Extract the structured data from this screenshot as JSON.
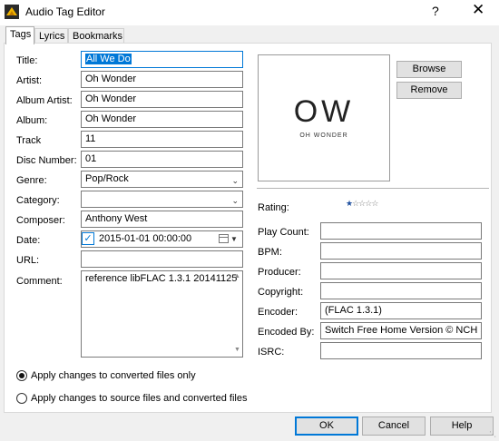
{
  "window": {
    "title": "Audio Tag Editor",
    "help": "?",
    "close": "✕"
  },
  "tabs": [
    "Tags",
    "Lyrics",
    "Bookmarks"
  ],
  "fields": {
    "title": {
      "label": "Title:",
      "value": "All We Do"
    },
    "artist": {
      "label": "Artist:",
      "value": "Oh Wonder"
    },
    "album_artist": {
      "label": "Album Artist:",
      "value": "Oh Wonder"
    },
    "album": {
      "label": "Album:",
      "value": "Oh Wonder"
    },
    "track": {
      "label": "Track",
      "value": "11"
    },
    "disc_number": {
      "label": "Disc Number:",
      "value": "01"
    },
    "genre": {
      "label": "Genre:",
      "value": "Pop/Rock"
    },
    "category": {
      "label": "Category:",
      "value": ""
    },
    "composer": {
      "label": "Composer:",
      "value": "Anthony West"
    },
    "date": {
      "label": "Date:",
      "value": "2015-01-01 00:00:00",
      "checked": true
    },
    "url": {
      "label": "URL:",
      "value": ""
    },
    "comment": {
      "label": "Comment:",
      "value": "reference libFLAC 1.3.1 20141125"
    }
  },
  "cover": {
    "big_text": "OW",
    "small_text": "OH WONDER"
  },
  "buttons": {
    "browse": "Browse",
    "remove": "Remove",
    "ok": "OK",
    "cancel": "Cancel",
    "help": "Help"
  },
  "rating": {
    "label": "Rating:",
    "value": 1,
    "max": 5
  },
  "right_fields": {
    "play_count": {
      "label": "Play Count:",
      "value": ""
    },
    "bpm": {
      "label": "BPM:",
      "value": ""
    },
    "producer": {
      "label": "Producer:",
      "value": ""
    },
    "copyright": {
      "label": "Copyright:",
      "value": ""
    },
    "encoder": {
      "label": "Encoder:",
      "value": "(FLAC 1.3.1)"
    },
    "encoded_by": {
      "label": "Encoded By:",
      "value": "Switch Free Home Version © NCH Software"
    },
    "isrc": {
      "label": "ISRC:",
      "value": ""
    }
  },
  "apply": {
    "converted_only": "Apply changes to converted files only",
    "source_and_converted": "Apply changes to source files and converted files",
    "selected": "converted_only"
  },
  "colors": {
    "accent": "#0078d7",
    "selection": "#0078d7",
    "star": "#1e4f9e"
  }
}
